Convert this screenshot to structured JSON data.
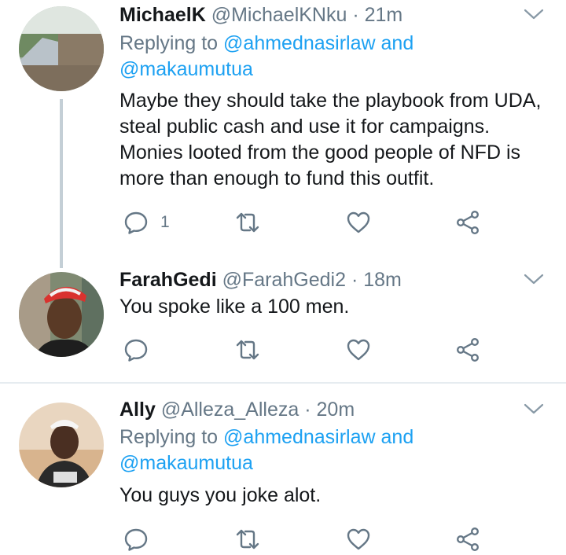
{
  "tweets": [
    {
      "name": "MichaelK",
      "handle": "@MichaelKNku",
      "dot": "·",
      "time": "21m",
      "replying_prefix": "Replying to",
      "reply_mention_1": "@ahmednasirlaw",
      "reply_and": "and",
      "reply_mention_2": "@makaumutua",
      "text": "Maybe they should take the playbook from UDA, steal public cash and use it for campaigns. Monies looted from the good people of NFD is more than enough to fund this outfit.",
      "reply_count": "1"
    },
    {
      "name": "FarahGedi",
      "handle": "@FarahGedi2",
      "dot": "·",
      "time": "18m",
      "text": "You spoke like a 100 men.",
      "reply_count": ""
    },
    {
      "name": "Ally",
      "handle": "@Alleza_Alleza",
      "dot": "·",
      "time": "20m",
      "replying_prefix": "Replying to",
      "reply_mention_1": "@ahmednasirlaw",
      "reply_and": "and",
      "reply_mention_2": "@makaumutua",
      "text": "You guys you joke alot."
    }
  ],
  "icons": {
    "reply": "reply-icon",
    "retweet": "retweet-icon",
    "like": "heart-icon",
    "share": "share-icon",
    "caret": "chevron-down-icon"
  },
  "colors": {
    "link": "#1da1f2",
    "secondary_text": "#657786",
    "thread_line": "#c4cfd6",
    "divider": "#e6ecf0"
  }
}
